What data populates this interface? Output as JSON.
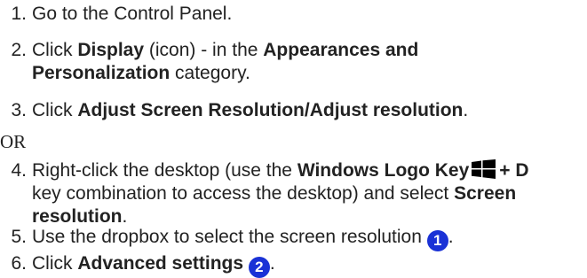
{
  "steps": [
    {
      "number": "1.",
      "text": "Go to the Control Panel."
    },
    {
      "number": "2.",
      "click": "Click ",
      "display": "Display",
      "icon_paren": " (icon) - in the ",
      "category": "Appearances and",
      "category2": "Personalization",
      "category_suffix": " category."
    },
    {
      "number": "3.",
      "click": "Click ",
      "target": "Adjust Screen Resolution/Adjust resolution",
      "period": "."
    },
    {
      "number": "4.",
      "lead": "Right-click the desktop (use the ",
      "key_label": "Windows Logo Key",
      "key_icon": "windows-logo",
      "combo": "+ D",
      "line2": "key combination to access the desktop) and select ",
      "screen": "Screen",
      "resolution": "resolution",
      "period": "."
    },
    {
      "number": "5.",
      "text": "Use the dropbox to select the screen resolution ",
      "badge": "1",
      "period": "."
    },
    {
      "number": "6.",
      "click": "Click ",
      "target": "Advanced settings",
      "badge": "2",
      "period": "."
    }
  ],
  "separator": "OR",
  "colors": {
    "badge": "#1a32d6",
    "text": "#222222"
  }
}
